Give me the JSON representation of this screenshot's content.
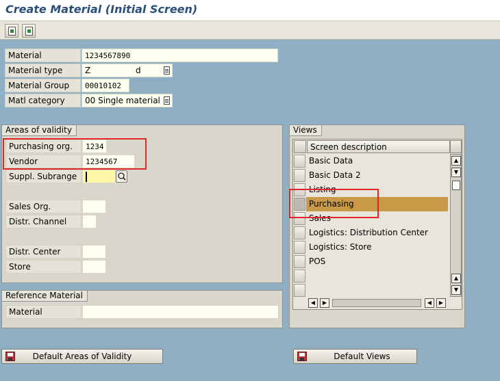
{
  "window": {
    "title": "Create Material (Initial Screen)"
  },
  "toolbar": {
    "buttons": [
      {
        "icon": "select-views-icon"
      },
      {
        "icon": "org-levels-icon"
      }
    ]
  },
  "header_fields": {
    "material": {
      "label": "Material",
      "value": "1234567890"
    },
    "material_type": {
      "label": "Material type",
      "value": "Z",
      "value_tail": "d"
    },
    "material_group": {
      "label": "Material Group",
      "value": "00010102"
    },
    "matl_category": {
      "label": "Matl category",
      "value": "00 Single material"
    }
  },
  "areas_of_validity": {
    "title": "Areas of validity",
    "purchasing_org": {
      "label": "Purchasing org.",
      "value": "1234"
    },
    "vendor": {
      "label": "Vendor",
      "value": "1234567"
    },
    "suppl_subrange": {
      "label": "Suppl. Subrange",
      "value": ""
    },
    "sales_org": {
      "label": "Sales Org.",
      "value": ""
    },
    "distr_channel": {
      "label": "Distr. Channel",
      "value": ""
    },
    "distr_center": {
      "label": "Distr. Center",
      "value": ""
    },
    "store": {
      "label": "Store",
      "value": ""
    }
  },
  "reference_material": {
    "title": "Reference Material",
    "material": {
      "label": "Material",
      "value": ""
    }
  },
  "views": {
    "title": "Views",
    "column_header": "Screen description",
    "rows": [
      {
        "label": "Basic Data",
        "selected": false
      },
      {
        "label": "Basic Data 2",
        "selected": false
      },
      {
        "label": "Listing",
        "selected": false
      },
      {
        "label": "Purchasing",
        "selected": true
      },
      {
        "label": "Sales",
        "selected": false
      },
      {
        "label": "Logistics: Distribution Center",
        "selected": false
      },
      {
        "label": "Logistics: Store",
        "selected": false
      },
      {
        "label": "POS",
        "selected": false
      },
      {
        "label": "",
        "selected": false
      }
    ],
    "selected_color": "#c89a48"
  },
  "buttons": {
    "default_areas": "Default Areas of Validity",
    "default_views": "Default Views"
  },
  "highlight_color": "#e0262a"
}
